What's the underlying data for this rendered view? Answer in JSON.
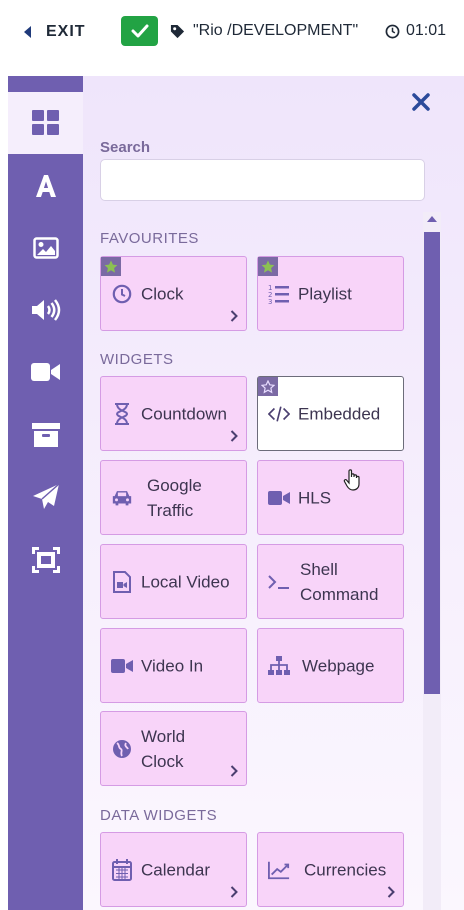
{
  "topbar": {
    "exit_label": "EXIT",
    "layout_name": "\"Rio /DEVELOPMENT\"",
    "duration": "01:01",
    "icons": [
      "caret-left-icon",
      "check-icon",
      "tag-icon",
      "clock-icon"
    ]
  },
  "sidebar": {
    "items": [
      {
        "name": "widgets-icon",
        "active": true
      },
      {
        "name": "text-icon"
      },
      {
        "name": "image-icon"
      },
      {
        "name": "audio-icon"
      },
      {
        "name": "video-icon"
      },
      {
        "name": "archive-icon"
      },
      {
        "name": "send-icon"
      },
      {
        "name": "expand-icon"
      }
    ]
  },
  "panel": {
    "search_label": "Search",
    "search_value": "",
    "search_placeholder": "",
    "sections": {
      "favourites": "FAVOURITES",
      "widgets": "WIDGETS",
      "data_widgets": "DATA WIDGETS"
    },
    "favourites": [
      {
        "label": "Clock",
        "icon": "clock-icon",
        "starred": true,
        "has_chevron": true
      },
      {
        "label": "Playlist",
        "icon": "list-icon",
        "starred": true,
        "has_chevron": false
      }
    ],
    "widgets": [
      {
        "label": "Countdown",
        "icon": "hourglass-icon",
        "has_chevron": true
      },
      {
        "label": "Embedded",
        "icon": "code-icon",
        "starred": false,
        "hovered": true
      },
      {
        "label": "Google\nTraffic",
        "icon": "car-icon"
      },
      {
        "label": "HLS",
        "icon": "video-icon"
      },
      {
        "label": "Local Video",
        "icon": "file-video-icon"
      },
      {
        "label": "Shell\nCommand",
        "icon": "terminal-icon"
      },
      {
        "label": "Video In",
        "icon": "video-icon"
      },
      {
        "label": "Webpage",
        "icon": "sitemap-icon"
      },
      {
        "label": "World\nClock",
        "icon": "globe-icon",
        "has_chevron": true
      }
    ],
    "data_widgets": [
      {
        "label": "Calendar",
        "icon": "calendar-icon",
        "has_chevron": true
      },
      {
        "label": "Currencies",
        "icon": "chart-line-icon",
        "has_chevron": true
      }
    ]
  },
  "colors": {
    "sidebar": "#6f5fb0",
    "card_bg": "#f8d4f9",
    "card_border": "#d59be4",
    "accent_green": "#22a344",
    "star_green": "#8cc152",
    "close": "#2b4a9a"
  }
}
